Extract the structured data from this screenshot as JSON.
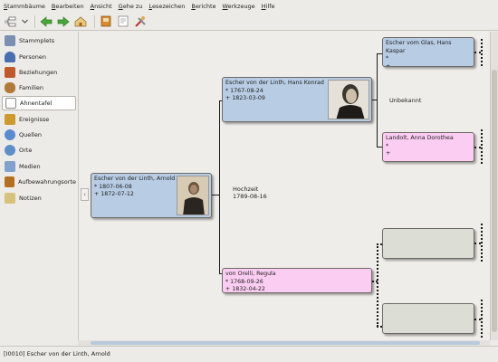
{
  "menubar": {
    "items": [
      "Stammbäume",
      "Bearbeiten",
      "Ansicht",
      "Gehe zu",
      "Lesezeichen",
      "Berichte",
      "Werkzeuge",
      "Hilfe"
    ]
  },
  "sidebar": {
    "items": [
      {
        "label": "Stammplets",
        "icon": "home-list-icon",
        "color": "#7a8fb1"
      },
      {
        "label": "Personen",
        "icon": "person-icon",
        "color": "#4a6fb0"
      },
      {
        "label": "Beziehungen",
        "icon": "relationships-icon",
        "color": "#c05a2a"
      },
      {
        "label": "Familien",
        "icon": "family-icon",
        "color": "#b07b3a"
      },
      {
        "label": "Ahnentafel",
        "icon": "pedigree-icon",
        "color": "#888888"
      },
      {
        "label": "Ereignisse",
        "icon": "events-icon",
        "color": "#cc9a2e"
      },
      {
        "label": "Quellen",
        "icon": "sources-icon",
        "color": "#5a8ad0"
      },
      {
        "label": "Orte",
        "icon": "places-icon",
        "color": "#5d8ec7"
      },
      {
        "label": "Medien",
        "icon": "media-icon",
        "color": "#7fa2cf"
      },
      {
        "label": "Aufbewahrungsorte",
        "icon": "repositories-icon",
        "color": "#b5701f"
      },
      {
        "label": "Notizen",
        "icon": "notes-icon",
        "color": "#d7c27a"
      }
    ],
    "selected_index": 4
  },
  "tree": {
    "root": {
      "name": "Escher von der Linth, Arnold",
      "birth": "* 1807-06-08",
      "death": "+ 1872-07-12"
    },
    "father": {
      "name": "Escher von der Linth, Hans Konrad",
      "birth": "* 1767-08-24",
      "death": "+ 1823-03-09"
    },
    "mother": {
      "name": "von Orelli, Regula",
      "birth": "* 1768-09-26",
      "death": "+ 1832-04-22"
    },
    "paternal_grandfather": {
      "name": "Escher vom Glas, Hans Kaspar",
      "birth": "*",
      "death": "+"
    },
    "paternal_grandmother": {
      "name": "Landolt, Anna Dorothea",
      "birth": "*",
      "death": "+"
    },
    "marriage_label": "Hochzeit",
    "marriage_date": "1789-08-16",
    "grandparents_relation": "Unbekannt"
  },
  "status": {
    "text": "[I0010] Escher von der Linth, Arnold"
  },
  "colors": {
    "male": "#b8cce4",
    "female": "#fccdf2",
    "empty": "#dcddd4"
  }
}
